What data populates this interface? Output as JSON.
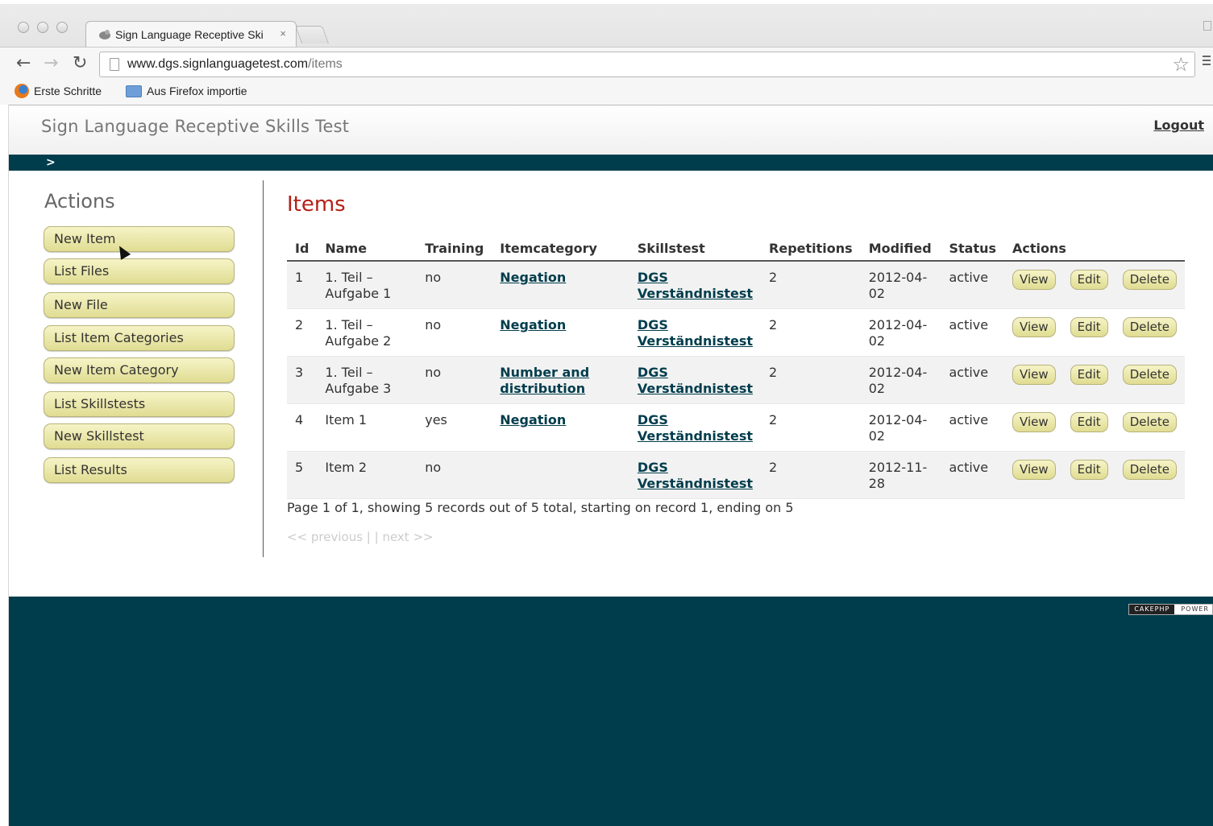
{
  "browser": {
    "tab_title": "Sign Language Receptive Ski",
    "tab_close": "×",
    "url_domain": "www.dgs.signlanguagetest.com",
    "url_path": "/items",
    "bookmarks": [
      "Erste Schritte",
      "Aus Firefox importie"
    ]
  },
  "header": {
    "site_title": "Sign Language Receptive Skills Test",
    "logout": "Logout",
    "breadcrumb": ">"
  },
  "sidebar": {
    "heading": "Actions",
    "buttons": [
      "New Item",
      "List Files",
      "New File",
      "List Item Categories",
      "New Item Category",
      "List Skillstests",
      "New Skillstest",
      "List Results"
    ]
  },
  "main": {
    "title": "Items",
    "columns": [
      "Id",
      "Name",
      "Training",
      "Itemcategory",
      "Skillstest",
      "Repetitions",
      "Modified",
      "Status",
      "Actions"
    ],
    "rows": [
      {
        "id": "1",
        "name": "1. Teil – Aufgabe 1",
        "training": "no",
        "category": "Negation",
        "skillstest": "DGS Verständnistest",
        "repetitions": "2",
        "modified": "2012-04-02",
        "status": "active"
      },
      {
        "id": "2",
        "name": "1. Teil – Aufgabe 2",
        "training": "no",
        "category": "Negation",
        "skillstest": "DGS Verständnistest",
        "repetitions": "2",
        "modified": "2012-04-02",
        "status": "active"
      },
      {
        "id": "3",
        "name": "1. Teil – Aufgabe 3",
        "training": "no",
        "category": "Number and distribution",
        "skillstest": "DGS Verständnistest",
        "repetitions": "2",
        "modified": "2012-04-02",
        "status": "active"
      },
      {
        "id": "4",
        "name": "Item 1",
        "training": "yes",
        "category": "Negation",
        "skillstest": "DGS Verständnistest",
        "repetitions": "2",
        "modified": "2012-04-02",
        "status": "active"
      },
      {
        "id": "5",
        "name": "Item 2",
        "training": "no",
        "category": "",
        "skillstest": "DGS Verständnistest",
        "repetitions": "2",
        "modified": "2012-11-28",
        "status": "active"
      }
    ],
    "action_labels": {
      "view": "View",
      "edit": "Edit",
      "delete": "Delete"
    },
    "paging_summary": "Page 1 of 1, showing 5 records out of 5 total, starting on record 1, ending on 5",
    "paging_links": "<< previous | | next >>"
  },
  "footer": {
    "badge_left": "CAKEPHP",
    "badge_right": "POWER"
  },
  "colors": {
    "accent_dark": "#003d4c",
    "title_red": "#b52018",
    "button_yellow": "#e8e5a4"
  }
}
